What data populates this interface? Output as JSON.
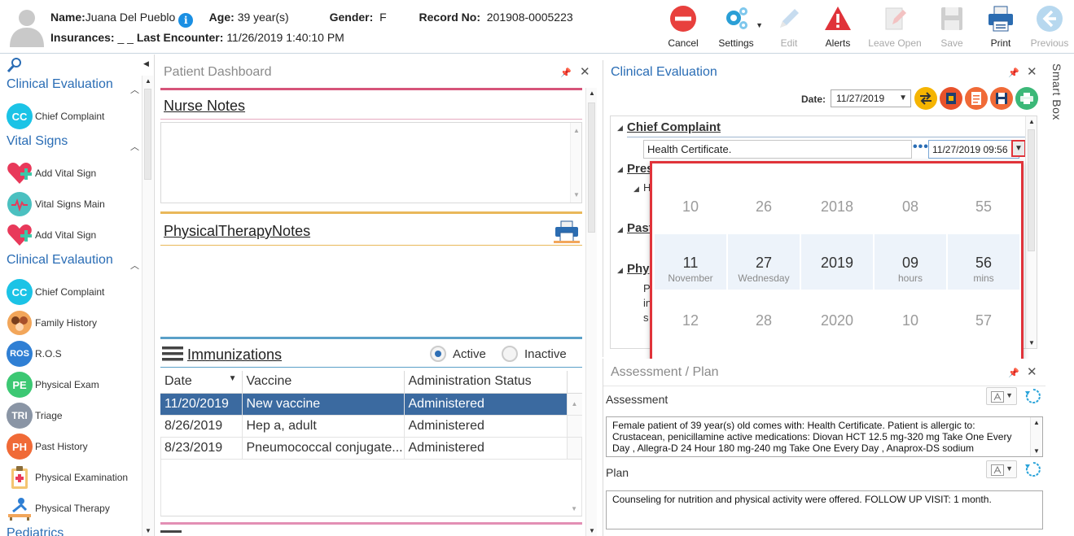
{
  "header": {
    "name_label": "Name:",
    "name_value": "Juana Del Pueblo",
    "age_label": "Age:",
    "age_value": "39 year(s)",
    "gender_label": "Gender:",
    "gender_value": "F",
    "record_label": "Record No:",
    "record_value": "201908-0005223",
    "insurances_label": "Insurances:",
    "insurances_value": "_ _",
    "last_encounter_label": "Last Encounter:",
    "last_encounter_value": "11/26/2019 1:40:10 PM",
    "info_glyph": "i"
  },
  "toolbar": {
    "cancel": "Cancel",
    "settings": "Settings",
    "edit": "Edit",
    "alerts": "Alerts",
    "leave_open": "Leave Open",
    "save": "Save",
    "print": "Print",
    "previous": "Previous"
  },
  "sidebar": {
    "sections": [
      {
        "title": "Clinical Evaluation"
      },
      {
        "title": "Vital Signs"
      },
      {
        "title": "Clinical Evalaution"
      },
      {
        "title": "Pediatrics"
      }
    ],
    "items": [
      {
        "label": "Chief Complaint",
        "badge": "CC"
      },
      {
        "label": "Add Vital Sign"
      },
      {
        "label": "Vital Signs Main"
      },
      {
        "label": "Add Vital Sign"
      },
      {
        "label": "Chief Complaint",
        "badge": "CC"
      },
      {
        "label": "Family History"
      },
      {
        "label": "R.O.S",
        "badge": "ROS"
      },
      {
        "label": "Physical Exam",
        "badge": "PE"
      },
      {
        "label": "Triage",
        "badge": "TRI"
      },
      {
        "label": "Past History",
        "badge": "PH"
      },
      {
        "label": "Physical Examination"
      },
      {
        "label": "Physical Therapy"
      }
    ]
  },
  "dashboard": {
    "title": "Patient Dashboard",
    "nurse_notes": "Nurse Notes",
    "pt_notes": "PhysicalTherapyNotes",
    "immunizations": {
      "title": "Immunizations",
      "active_label": "Active",
      "inactive_label": "Inactive",
      "columns": [
        "Date",
        "Vaccine",
        "Administration Status"
      ],
      "rows": [
        [
          "11/20/2019",
          "New vaccine",
          "Administered"
        ],
        [
          "8/26/2019",
          "Hep a, adult",
          "Administered"
        ],
        [
          "8/23/2019",
          "Pneumococcal conjugate...",
          "Administered"
        ]
      ]
    }
  },
  "clinical": {
    "title": "Clinical Evaluation",
    "date_label": "Date:",
    "date_value": "11/27/2019",
    "tree": {
      "chief_complaint": "Chief Complaint",
      "cc_text": "Health Certificate.",
      "cc_datetime": "11/27/2019 09:56",
      "partial_1": "Pres",
      "partial_1b": "H",
      "partial_2": "Past",
      "partial_3": "Phy",
      "partial_3a": "P",
      "partial_3b": "in",
      "partial_3c": "s"
    }
  },
  "picker": {
    "columns": [
      {
        "prev": "10",
        "cur": "11",
        "cur_sub": "November",
        "next": "12"
      },
      {
        "prev": "26",
        "cur": "27",
        "cur_sub": "Wednesday",
        "next": "28"
      },
      {
        "prev": "2018",
        "cur": "2019",
        "cur_sub": "",
        "next": "2020"
      },
      {
        "prev": "08",
        "cur": "09",
        "cur_sub": "hours",
        "next": "10"
      },
      {
        "prev": "55",
        "cur": "56",
        "cur_sub": "mins",
        "next": "57"
      }
    ]
  },
  "assessment_plan": {
    "title": "Assessment / Plan",
    "assessment_label": "Assessment",
    "assessment_text": "Female patient of 39 year(s) old  comes with: Health Certificate.        Patient is allergic to: Crustacean, penicillamine   active medications:  Diovan HCT 12.5 mg-320 mg Take One Every Day , Allegra-D 24 Hour 180 mg-240 mg Take One Every Day , Anaprox-DS sodium",
    "plan_label": "Plan",
    "plan_text": "    Counseling for nutrition and physical activity were offered.     FOLLOW UP VISIT: 1 month."
  },
  "smart_box": "Smart Box",
  "colors": {
    "accent_blue": "#2a6db5",
    "highlight_red": "#e0333a",
    "selected_row": "#3b6aa0",
    "nurse_bar": "#d6547a",
    "pt_bar": "#e9b85a",
    "imm_bar": "#5aa0c8"
  }
}
